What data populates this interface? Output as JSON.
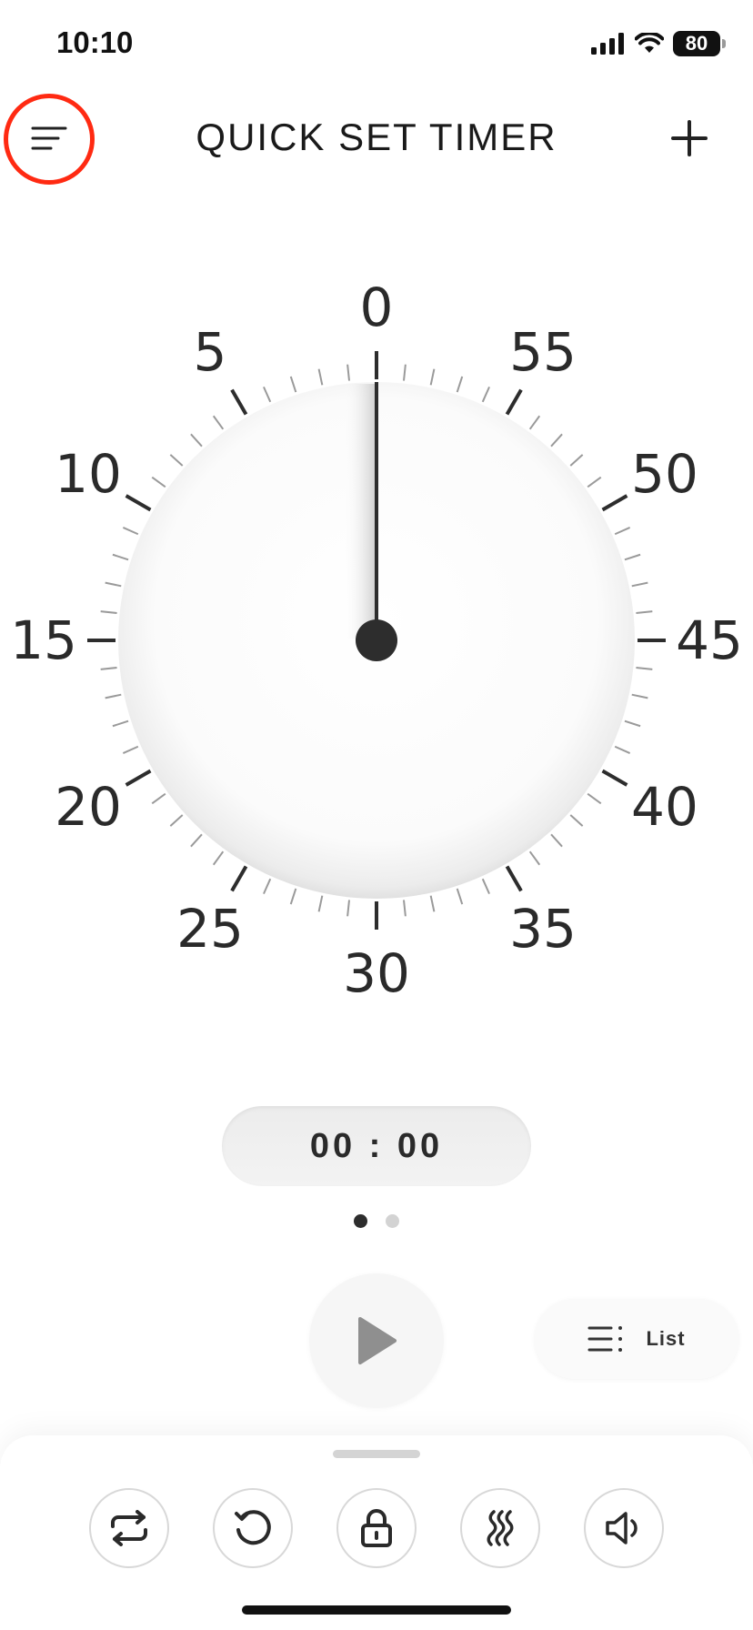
{
  "status_bar": {
    "time": "10:10",
    "battery": "80",
    "icons": [
      "cellular-signal-icon",
      "wifi-icon",
      "battery-icon"
    ]
  },
  "header": {
    "title": "QUICK SET TIMER",
    "menu_icon": "menu-lines-icon",
    "add_icon": "plus-icon"
  },
  "dial": {
    "labels": [
      "0",
      "5",
      "10",
      "15",
      "20",
      "25",
      "30",
      "35",
      "40",
      "45",
      "50",
      "55"
    ],
    "hand_value_minutes": 0
  },
  "timer": {
    "display": "00 : 00"
  },
  "pager": {
    "count": 2,
    "active_index": 0
  },
  "controls": {
    "play_icon": "play-icon",
    "list_label": "List",
    "list_icon": "list-icon"
  },
  "tools": [
    {
      "name": "repeat-icon"
    },
    {
      "name": "reset-icon"
    },
    {
      "name": "lock-icon"
    },
    {
      "name": "vibrate-icon"
    },
    {
      "name": "volume-icon"
    }
  ],
  "colors": {
    "highlight_ring": "#ff2a12",
    "dark": "#2d2d2d",
    "face": "#ffffff"
  }
}
